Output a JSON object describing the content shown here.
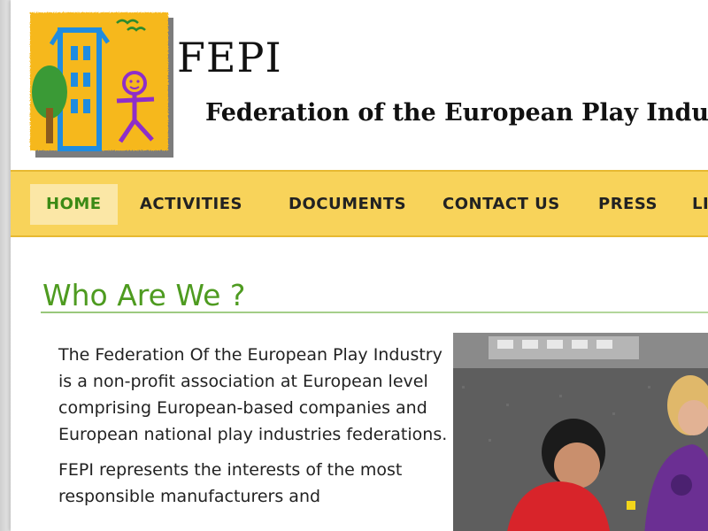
{
  "header": {
    "title": "FEPI",
    "subtitle": "Federation of the European Play Industry"
  },
  "nav": {
    "items": [
      {
        "label": "HOME",
        "active": true
      },
      {
        "label": "ACTIVITIES",
        "active": false
      },
      {
        "label": "DOCUMENTS",
        "active": false
      },
      {
        "label": "CONTACT US",
        "active": false
      },
      {
        "label": "PRESS",
        "active": false
      },
      {
        "label": "LI",
        "active": false
      }
    ]
  },
  "main": {
    "section_title": "Who Are We ?",
    "paragraphs": [
      "The Federation Of the European Play Industry is a non-profit association at European level comprising European-based companies and European national play industries federations.",
      "FEPI represents the interests of the most responsible manufacturers and"
    ]
  },
  "icons": {
    "logo": "children-playground-logo-icon",
    "photo": "children-playing-photo"
  },
  "colors": {
    "accent_green": "#4e9b20",
    "nav_yellow": "#f8d35a",
    "nav_active_bg": "#fbe7a6",
    "nav_active_text": "#3b8a15"
  }
}
